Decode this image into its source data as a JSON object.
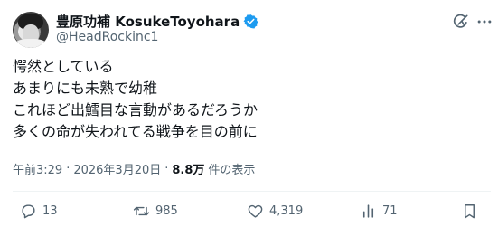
{
  "author": {
    "display_name": "豊原功補 KosukeToyohara",
    "handle": "@HeadRockinc1"
  },
  "tweet": {
    "lines": [
      "愕然としている",
      "あまりにも未熟で幼稚",
      "これほど出鱈目な言動があるだろうか",
      "多くの命が失われてる戦争を目の前に"
    ]
  },
  "meta": {
    "time": "午前3:29",
    "separator1": "·",
    "date": "2026年3月20日",
    "separator2": "·",
    "views_count": "8.8万",
    "views_label": "件の表示"
  },
  "actions": {
    "replies": "13",
    "retweets": "985",
    "likes": "4,319",
    "views": "71"
  },
  "colors": {
    "text": "#0f1419",
    "secondary": "#536471",
    "verified": "#1d9bf0"
  }
}
